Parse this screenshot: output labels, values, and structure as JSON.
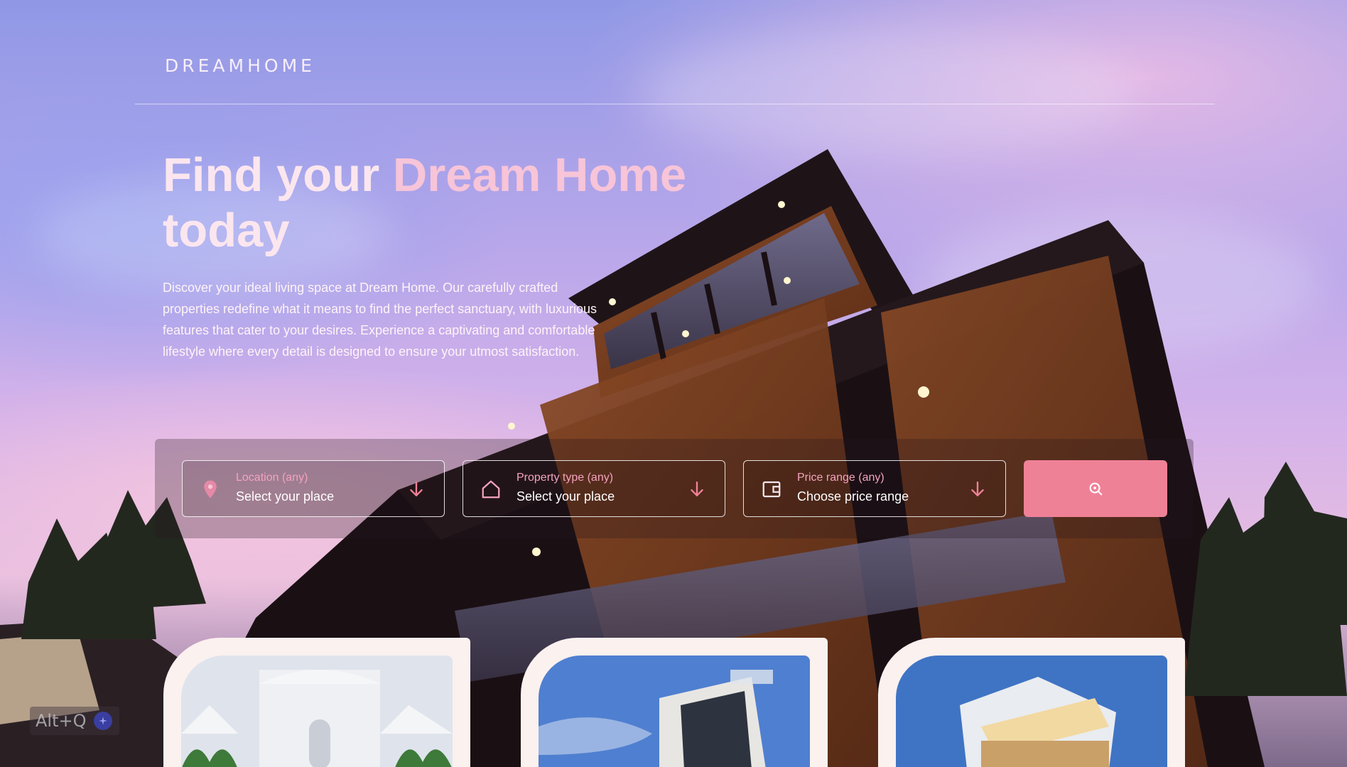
{
  "brand": {
    "logo_text": "DREAMHOME"
  },
  "hero": {
    "title_part1": "Find your ",
    "title_accent": "Dream Home",
    "title_part2": "today",
    "description": "Discover your ideal living space at Dream Home. Our carefully crafted properties redefine what it means to find the perfect sanctuary, with luxurious features that cater to your desires. Experience a captivating and comfortable lifestyle where every detail is designed to ensure your utmost satisfaction."
  },
  "search": {
    "fields": [
      {
        "label": "Location (any)",
        "value": "Select your place",
        "icon": "map-pin-icon"
      },
      {
        "label": "Property type (any)",
        "value": "Select your place",
        "icon": "house-icon"
      },
      {
        "label": "Price range (any)",
        "value": "Choose price range",
        "icon": "wallet-icon"
      }
    ],
    "button_icon": "search-icon"
  },
  "cards": [
    {
      "name": "property-card-1"
    },
    {
      "name": "property-card-2"
    },
    {
      "name": "property-card-3"
    }
  ],
  "overlay": {
    "shortcut_label": "Alt+Q"
  },
  "colors": {
    "accent_pink": "#ef8197",
    "label_pink": "#f4a2bf",
    "card_bg": "#fbf1ef"
  }
}
